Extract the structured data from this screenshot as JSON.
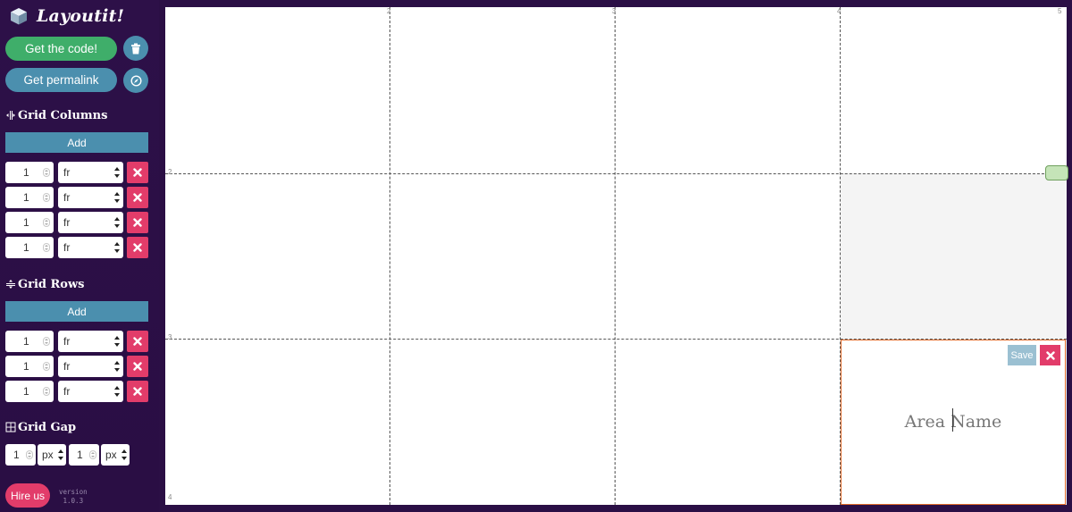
{
  "app": {
    "title": "Layoutit!"
  },
  "actions": {
    "get_code": "Get the code!",
    "get_permalink": "Get permalink"
  },
  "columns": {
    "title": "Grid Columns",
    "add_label": "Add",
    "items": [
      {
        "value": "1",
        "unit": "fr"
      },
      {
        "value": "1",
        "unit": "fr"
      },
      {
        "value": "1",
        "unit": "fr"
      },
      {
        "value": "1",
        "unit": "fr"
      }
    ]
  },
  "rows": {
    "title": "Grid Rows",
    "add_label": "Add",
    "items": [
      {
        "value": "1",
        "unit": "fr"
      },
      {
        "value": "1",
        "unit": "fr"
      },
      {
        "value": "1",
        "unit": "fr"
      }
    ]
  },
  "gap": {
    "title": "Grid Gap",
    "column": {
      "value": "1",
      "unit": "px"
    },
    "row": {
      "value": "1",
      "unit": "px"
    }
  },
  "footer": {
    "hire_label": "Hire us",
    "version_label": "version",
    "version_number": "1.0.3"
  },
  "canvas": {
    "column_line_labels": [
      "2",
      "3",
      "4",
      "5"
    ],
    "row_line_labels": [
      "2",
      "3",
      "4"
    ],
    "area_editor": {
      "placeholder": "Area Name",
      "save_label": "Save"
    }
  },
  "colors": {
    "sidebar_bg": "#2b0f45",
    "primary_green": "#3fae6a",
    "primary_blue": "#4b8fae",
    "delete_pink": "#e23c6a",
    "editor_border": "#e06b2b"
  },
  "icons": {
    "logo": "cube-icon",
    "trash": "trash-icon",
    "permalink": "compass-icon",
    "columns": "columns-icon",
    "rows": "rows-icon",
    "gap": "grid-icon",
    "delete": "close-icon"
  }
}
